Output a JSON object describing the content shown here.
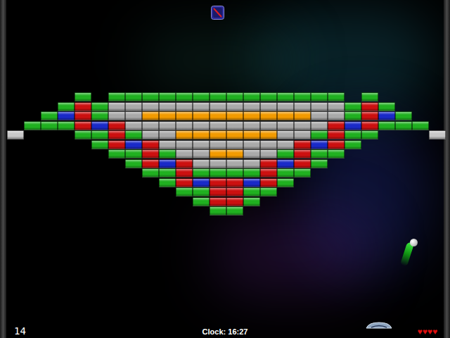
{
  "score": "14",
  "clock": "Clock: 16:27",
  "lives": "♥♥♥♥",
  "bricks": [
    [
      null,
      null,
      null,
      null,
      {
        "color": "#20b020"
      },
      null,
      {
        "color": "#20b020"
      },
      {
        "color": "#20b020"
      },
      {
        "color": "#20b020"
      },
      {
        "color": "#20b020"
      },
      {
        "color": "#20b020"
      },
      {
        "color": "#20b020"
      },
      {
        "color": "#20b020"
      },
      {
        "color": "#20b020"
      },
      {
        "color": "#20b020"
      },
      {
        "color": "#20b020"
      },
      {
        "color": "#20b020"
      },
      {
        "color": "#20b020"
      },
      {
        "color": "#20b020"
      },
      {
        "color": "#20b020"
      },
      null,
      {
        "color": "#20b020"
      },
      null,
      null,
      null,
      null
    ],
    [
      null,
      null,
      null,
      {
        "color": "#20b020"
      },
      {
        "color": "#cc1010"
      },
      {
        "color": "#20b020"
      },
      {
        "color": "#a9a9a9"
      },
      {
        "color": "#a9a9a9"
      },
      {
        "color": "#a9a9a9"
      },
      {
        "color": "#a9a9a9"
      },
      {
        "color": "#a9a9a9"
      },
      {
        "color": "#a9a9a9"
      },
      {
        "color": "#a9a9a9"
      },
      {
        "color": "#a9a9a9"
      },
      {
        "color": "#a9a9a9"
      },
      {
        "color": "#a9a9a9"
      },
      {
        "color": "#a9a9a9"
      },
      {
        "color": "#a9a9a9"
      },
      {
        "color": "#a9a9a9"
      },
      {
        "color": "#a9a9a9"
      },
      {
        "color": "#20b020"
      },
      {
        "color": "#cc1010"
      },
      {
        "color": "#20b020"
      },
      null,
      null,
      null
    ],
    [
      null,
      null,
      {
        "color": "#20b020"
      },
      {
        "color": "#1a2ac8"
      },
      {
        "color": "#cc1010"
      },
      {
        "color": "#20b020"
      },
      {
        "color": "#a9a9a9"
      },
      {
        "color": "#a9a9a9"
      },
      {
        "color": "#f29a00"
      },
      {
        "color": "#f29a00"
      },
      {
        "color": "#f29a00"
      },
      {
        "color": "#f29a00"
      },
      {
        "color": "#f29a00"
      },
      {
        "color": "#f29a00"
      },
      {
        "color": "#f29a00"
      },
      {
        "color": "#f29a00"
      },
      {
        "color": "#f29a00"
      },
      {
        "color": "#f29a00"
      },
      {
        "color": "#a9a9a9"
      },
      {
        "color": "#a9a9a9"
      },
      {
        "color": "#20b020"
      },
      {
        "color": "#cc1010"
      },
      {
        "color": "#1a2ac8"
      },
      {
        "color": "#20b020"
      },
      null,
      null
    ],
    [
      null,
      {
        "color": "#20b020"
      },
      {
        "color": "#20b020"
      },
      {
        "color": "#20b020"
      },
      {
        "color": "#cc1010"
      },
      {
        "color": "#1a2ac8"
      },
      {
        "color": "#cc1010"
      },
      {
        "color": "#a9a9a9"
      },
      {
        "color": "#a9a9a9"
      },
      {
        "color": "#a9a9a9"
      },
      {
        "color": "#a9a9a9"
      },
      {
        "color": "#a9a9a9"
      },
      {
        "color": "#a9a9a9"
      },
      {
        "color": "#a9a9a9"
      },
      {
        "color": "#a9a9a9"
      },
      {
        "color": "#a9a9a9"
      },
      {
        "color": "#a9a9a9"
      },
      {
        "color": "#a9a9a9"
      },
      {
        "color": "#a9a9a9"
      },
      {
        "color": "#cc1010"
      },
      {
        "color": "#1a2ac8"
      },
      {
        "color": "#cc1010"
      },
      {
        "color": "#20b020"
      },
      {
        "color": "#20b020"
      },
      {
        "color": "#20b020"
      },
      null
    ],
    [
      {
        "color": "#c8c8c8"
      },
      null,
      null,
      null,
      {
        "color": "#20b020"
      },
      {
        "color": "#20b020"
      },
      {
        "color": "#cc1010"
      },
      {
        "color": "#20b020"
      },
      {
        "color": "#a9a9a9"
      },
      {
        "color": "#a9a9a9"
      },
      {
        "color": "#f29a00"
      },
      {
        "color": "#f29a00"
      },
      {
        "color": "#f29a00"
      },
      {
        "color": "#f29a00"
      },
      {
        "color": "#f29a00"
      },
      {
        "color": "#f29a00"
      },
      {
        "color": "#a9a9a9"
      },
      {
        "color": "#a9a9a9"
      },
      {
        "color": "#20b020"
      },
      {
        "color": "#cc1010"
      },
      {
        "color": "#20b020"
      },
      {
        "color": "#20b020"
      },
      null,
      null,
      null,
      {
        "color": "#c8c8c8"
      }
    ],
    [
      null,
      null,
      null,
      null,
      null,
      {
        "color": "#20b020"
      },
      {
        "color": "#cc1010"
      },
      {
        "color": "#1a2ac8"
      },
      {
        "color": "#cc1010"
      },
      {
        "color": "#a9a9a9"
      },
      {
        "color": "#a9a9a9"
      },
      {
        "color": "#a9a9a9"
      },
      {
        "color": "#a9a9a9"
      },
      {
        "color": "#a9a9a9"
      },
      {
        "color": "#a9a9a9"
      },
      {
        "color": "#a9a9a9"
      },
      {
        "color": "#a9a9a9"
      },
      {
        "color": "#cc1010"
      },
      {
        "color": "#1a2ac8"
      },
      {
        "color": "#cc1010"
      },
      {
        "color": "#20b020"
      },
      null,
      null,
      null,
      null,
      null
    ],
    [
      null,
      null,
      null,
      null,
      null,
      null,
      {
        "color": "#20b020"
      },
      {
        "color": "#20b020"
      },
      {
        "color": "#cc1010"
      },
      {
        "color": "#20b020"
      },
      {
        "color": "#a9a9a9"
      },
      {
        "color": "#a9a9a9"
      },
      {
        "color": "#f29a00"
      },
      {
        "color": "#f29a00"
      },
      {
        "color": "#a9a9a9"
      },
      {
        "color": "#a9a9a9"
      },
      {
        "color": "#20b020"
      },
      {
        "color": "#cc1010"
      },
      {
        "color": "#20b020"
      },
      {
        "color": "#20b020"
      },
      null,
      null,
      null,
      null,
      null,
      null
    ],
    [
      null,
      null,
      null,
      null,
      null,
      null,
      null,
      {
        "color": "#20b020"
      },
      {
        "color": "#cc1010"
      },
      {
        "color": "#1a2ac8"
      },
      {
        "color": "#cc1010"
      },
      {
        "color": "#a9a9a9"
      },
      {
        "color": "#a9a9a9"
      },
      {
        "color": "#a9a9a9"
      },
      {
        "color": "#a9a9a9"
      },
      {
        "color": "#cc1010"
      },
      {
        "color": "#1a2ac8"
      },
      {
        "color": "#cc1010"
      },
      {
        "color": "#20b020"
      },
      null,
      null,
      null,
      null,
      null,
      null,
      null
    ],
    [
      null,
      null,
      null,
      null,
      null,
      null,
      null,
      null,
      {
        "color": "#20b020"
      },
      {
        "color": "#20b020"
      },
      {
        "color": "#cc1010"
      },
      {
        "color": "#20b020"
      },
      {
        "color": "#20b020"
      },
      {
        "color": "#20b020"
      },
      {
        "color": "#20b020"
      },
      {
        "color": "#cc1010"
      },
      {
        "color": "#20b020"
      },
      {
        "color": "#20b020"
      },
      null,
      null,
      null,
      null,
      null,
      null,
      null,
      null
    ],
    [
      null,
      null,
      null,
      null,
      null,
      null,
      null,
      null,
      null,
      {
        "color": "#20b020"
      },
      {
        "color": "#cc1010"
      },
      {
        "color": "#1a2ac8"
      },
      {
        "color": "#cc1010"
      },
      {
        "color": "#cc1010"
      },
      {
        "color": "#1a2ac8"
      },
      {
        "color": "#cc1010"
      },
      {
        "color": "#20b020"
      },
      null,
      null,
      null,
      null,
      null,
      null,
      null,
      null,
      null
    ],
    [
      null,
      null,
      null,
      null,
      null,
      null,
      null,
      null,
      null,
      null,
      {
        "color": "#20b020"
      },
      {
        "color": "#20b020"
      },
      {
        "color": "#cc1010"
      },
      {
        "color": "#cc1010"
      },
      {
        "color": "#20b020"
      },
      {
        "color": "#20b020"
      },
      null,
      null,
      null,
      null,
      null,
      null,
      null,
      null,
      null,
      null
    ],
    [
      null,
      null,
      null,
      null,
      null,
      null,
      null,
      null,
      null,
      null,
      null,
      {
        "color": "#20b020"
      },
      {
        "color": "#cc1010"
      },
      {
        "color": "#cc1010"
      },
      {
        "color": "#20b020"
      },
      null,
      null,
      null,
      null,
      null,
      null,
      null,
      null,
      null,
      null,
      null
    ],
    [
      null,
      null,
      null,
      null,
      null,
      null,
      null,
      null,
      null,
      null,
      null,
      null,
      {
        "color": "#20b020"
      },
      {
        "color": "#20b020"
      },
      null,
      null,
      null,
      null,
      null,
      null,
      null,
      null,
      null,
      null,
      null,
      null
    ]
  ]
}
